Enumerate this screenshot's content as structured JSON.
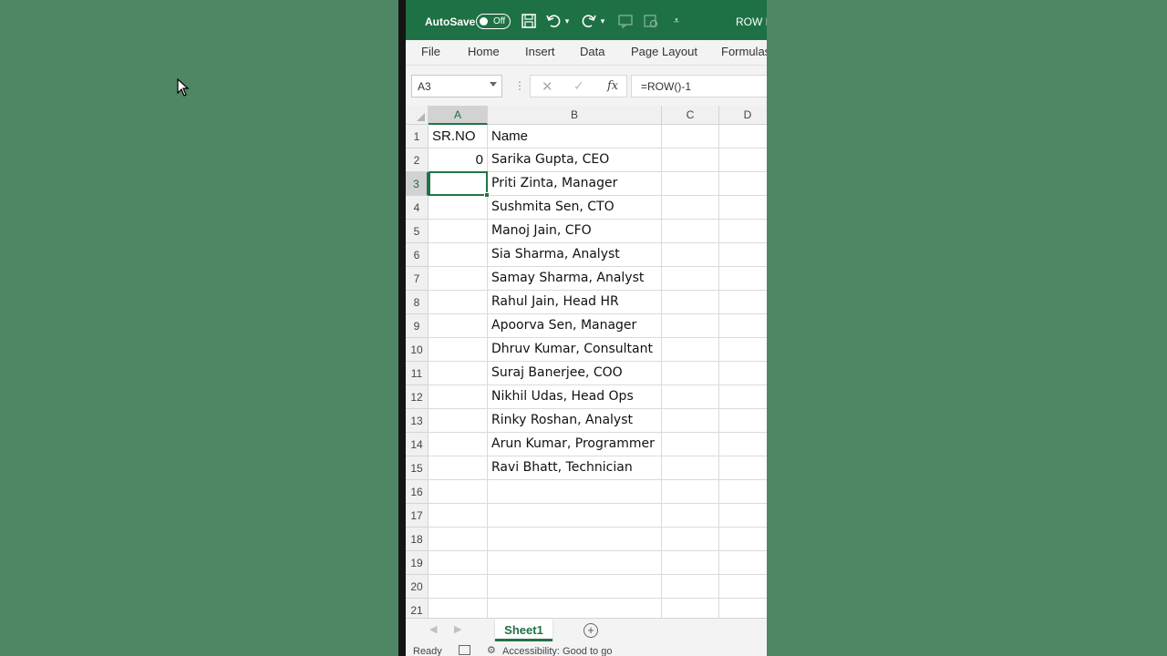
{
  "titlebar": {
    "autosave_label": "AutoSave",
    "autosave_state": "Off",
    "doc_title": "ROW F"
  },
  "ribbon": {
    "tabs": [
      "File",
      "Home",
      "Insert",
      "Data",
      "Page Layout",
      "Formulas"
    ]
  },
  "formula_bar": {
    "name_box": "A3",
    "fx_label": "fx",
    "formula": "=ROW()-1"
  },
  "grid": {
    "columns": [
      "A",
      "B",
      "C",
      "D"
    ],
    "selected_column": "A",
    "selected_row": 3,
    "rows": [
      {
        "num": "1",
        "a": "SR.NO",
        "b": "Name"
      },
      {
        "num": "2",
        "a": "0",
        "b": "Sarika Gupta, CEO"
      },
      {
        "num": "3",
        "a": "",
        "b": "Priti Zinta, Manager"
      },
      {
        "num": "4",
        "a": "",
        "b": "Sushmita Sen, CTO"
      },
      {
        "num": "5",
        "a": "",
        "b": "Manoj Jain, CFO"
      },
      {
        "num": "6",
        "a": "",
        "b": "Sia Sharma, Analyst"
      },
      {
        "num": "7",
        "a": "",
        "b": "Samay Sharma, Analyst"
      },
      {
        "num": "8",
        "a": "",
        "b": "Rahul Jain, Head HR"
      },
      {
        "num": "9",
        "a": "",
        "b": "Apoorva Sen, Manager"
      },
      {
        "num": "10",
        "a": "",
        "b": "Dhruv Kumar, Consultant"
      },
      {
        "num": "11",
        "a": "",
        "b": "Suraj Banerjee, COO"
      },
      {
        "num": "12",
        "a": "",
        "b": "Nikhil Udas, Head Ops"
      },
      {
        "num": "13",
        "a": "",
        "b": "Rinky Roshan, Analyst"
      },
      {
        "num": "14",
        "a": "",
        "b": "Arun Kumar, Programmer"
      },
      {
        "num": "15",
        "a": "",
        "b": "Ravi Bhatt, Technician"
      },
      {
        "num": "16",
        "a": "",
        "b": ""
      },
      {
        "num": "17",
        "a": "",
        "b": ""
      },
      {
        "num": "18",
        "a": "",
        "b": ""
      },
      {
        "num": "19",
        "a": "",
        "b": ""
      },
      {
        "num": "20",
        "a": "",
        "b": ""
      },
      {
        "num": "21",
        "a": "",
        "b": ""
      }
    ]
  },
  "sheets": {
    "active": "Sheet1"
  },
  "status": {
    "ready": "Ready",
    "accessibility": "Accessibility: Good to go"
  },
  "colors": {
    "excel_green": "#1e7145",
    "background": "#4f8664"
  }
}
